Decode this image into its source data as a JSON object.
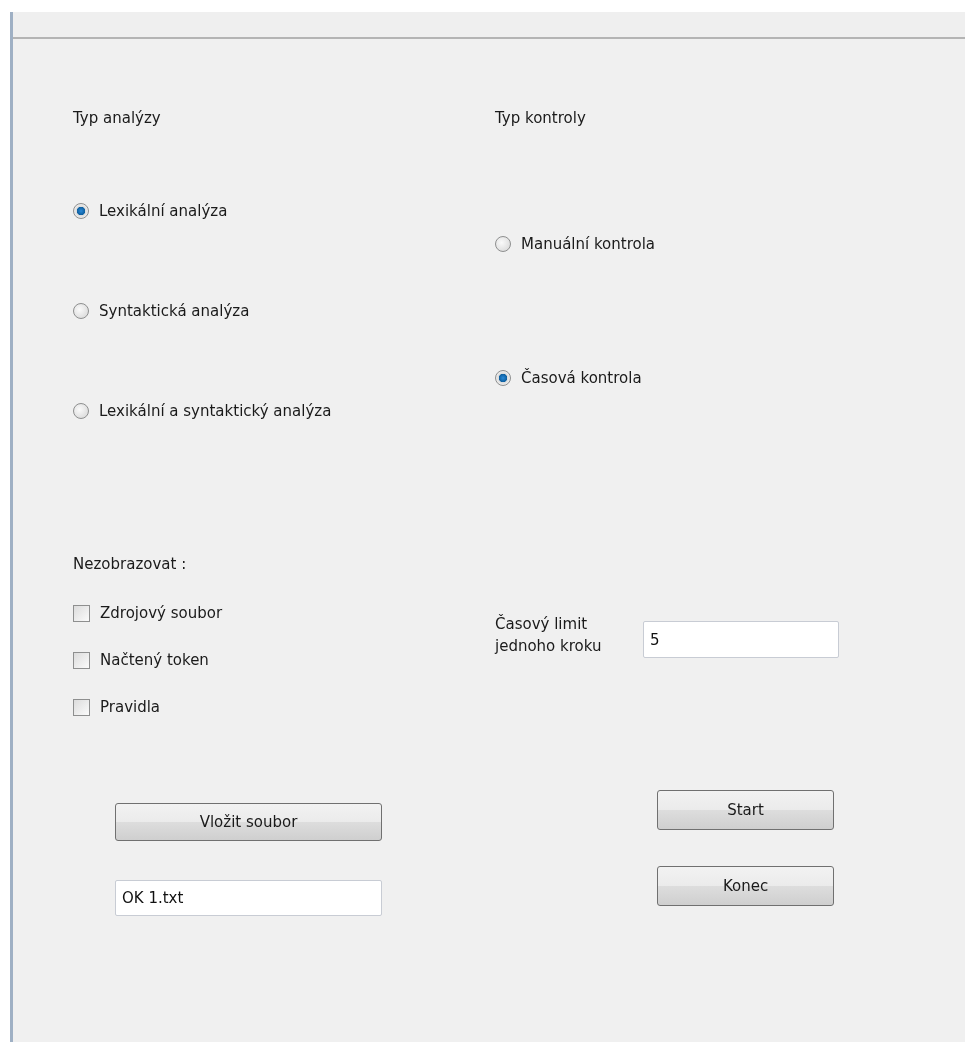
{
  "analysis": {
    "heading": "Typ analýzy",
    "options": [
      {
        "label": "Lexikální analýza",
        "selected": true
      },
      {
        "label": "Syntaktická analýza",
        "selected": false
      },
      {
        "label": "Lexikální a syntaktický analýza",
        "selected": false
      }
    ]
  },
  "control": {
    "heading": "Typ kontroly",
    "options": [
      {
        "label": "Manuální kontrola",
        "selected": false
      },
      {
        "label": "Časová kontrola",
        "selected": true
      }
    ]
  },
  "hide": {
    "heading": "Nezobrazovat :",
    "options": [
      {
        "label": "Zdrojový soubor",
        "checked": false
      },
      {
        "label": "Načtený token",
        "checked": false
      },
      {
        "label": "Pravidla",
        "checked": false
      }
    ]
  },
  "load_button": "Vložit soubor",
  "file_field": {
    "value": "OK 1.txt"
  },
  "time_limit": {
    "label": "Časový limit jednoho kroku",
    "value": "5"
  },
  "start_button": "Start",
  "exit_button": "Konec"
}
